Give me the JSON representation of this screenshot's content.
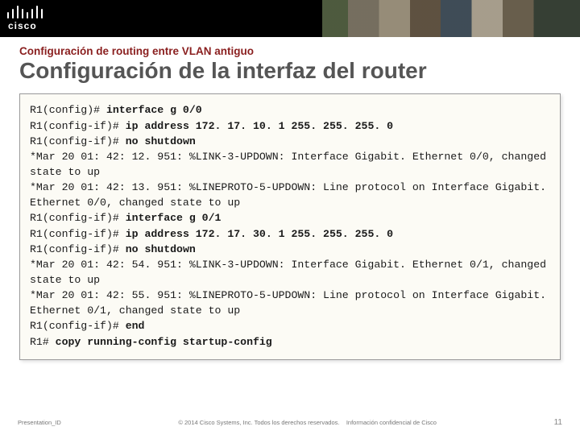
{
  "brand": {
    "name": "cisco"
  },
  "header": {
    "subtitle": "Configuración de routing entre VLAN antiguo",
    "title": "Configuración de la interfaz del router"
  },
  "code": {
    "lines": [
      {
        "prompt": "R1(config)# ",
        "cmd": "interface g 0/0"
      },
      {
        "prompt": "R1(config-if)# ",
        "cmd": "ip address 172. 17. 10. 1 255. 255. 255. 0"
      },
      {
        "prompt": "R1(config-if)# ",
        "cmd": "no shutdown"
      },
      {
        "plain": "*Mar 20 01: 42: 12. 951: %LINK-3-UPDOWN: Interface Gigabit. Ethernet 0/0, changed state to up"
      },
      {
        "plain": "*Mar 20 01: 42: 13. 951: %LINEPROTO-5-UPDOWN: Line protocol on Interface Gigabit. Ethernet 0/0, changed state to up"
      },
      {
        "prompt": "R1(config-if)# ",
        "cmd": "interface g 0/1"
      },
      {
        "prompt": "R1(config-if)# ",
        "cmd": "ip address 172. 17. 30. 1 255. 255. 255. 0"
      },
      {
        "prompt": "R1(config-if)# ",
        "cmd": "no shutdown"
      },
      {
        "plain": "*Mar 20 01: 42: 54. 951: %LINK-3-UPDOWN: Interface Gigabit. Ethernet 0/1, changed state to up"
      },
      {
        "plain": "*Mar 20 01: 42: 55. 951: %LINEPROTO-5-UPDOWN: Line protocol on Interface Gigabit. Ethernet 0/1, changed state to up"
      },
      {
        "prompt": "R1(config-if)# ",
        "cmd": "end"
      },
      {
        "prompt": "R1# ",
        "cmd": "copy running-config startup-config"
      }
    ]
  },
  "footer": {
    "id": "Presentation_ID",
    "copyright": "© 2014 Cisco Systems, Inc. Todos los derechos reservados.",
    "confidential": "Información confidencial de Cisco",
    "page": "11"
  }
}
